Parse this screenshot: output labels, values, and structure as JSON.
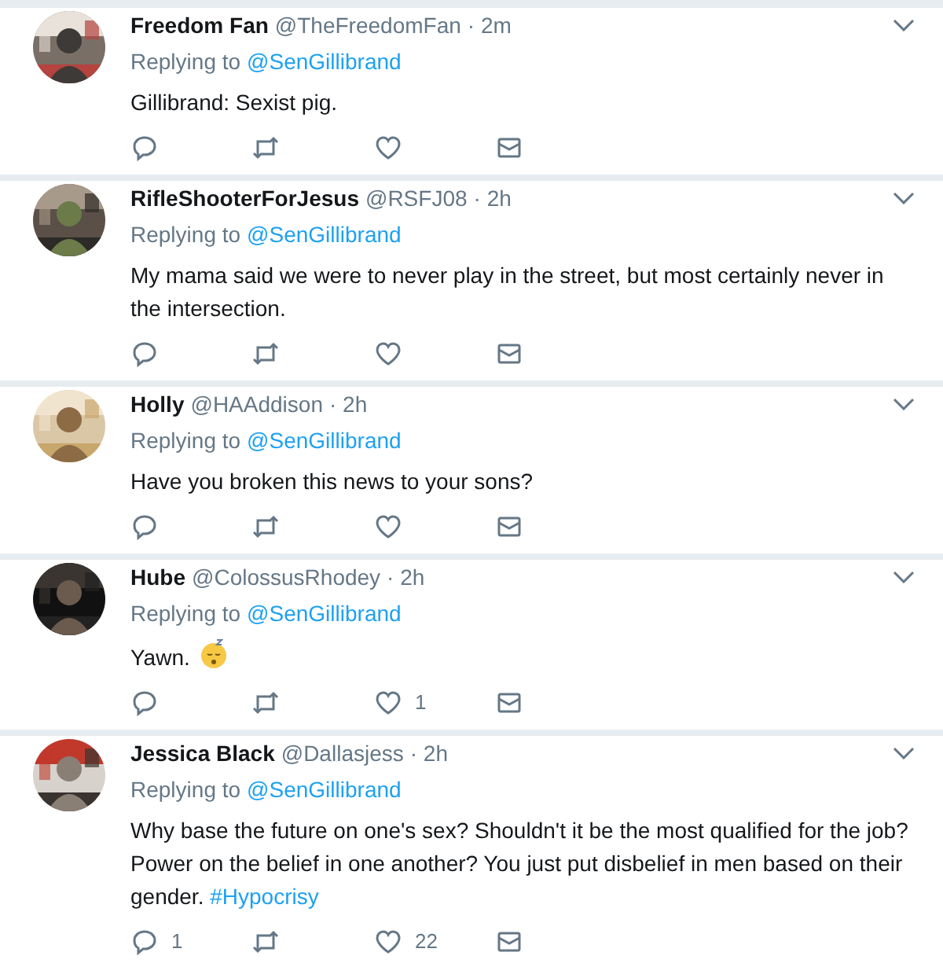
{
  "tweets": [
    {
      "name": "Freedom Fan",
      "handle": "@TheFreedomFan",
      "time": "· 2m",
      "replying_label": "Replying to",
      "replying_to": "@SenGillibrand",
      "body": "Gillibrand: Sexist pig."
    },
    {
      "name": "RifleShooterForJesus",
      "handle": "@RSFJ08",
      "time": "· 2h",
      "replying_label": "Replying to",
      "replying_to": "@SenGillibrand",
      "body": "My mama said we were to never play in the street, but most certainly never in the intersection."
    },
    {
      "name": "Holly",
      "handle": "@HAAddison",
      "time": "· 2h",
      "replying_label": "Replying to",
      "replying_to": "@SenGillibrand",
      "body": "Have you broken this news to your sons?"
    },
    {
      "name": "Hube",
      "handle": "@ColossusRhodey",
      "time": "· 2h",
      "replying_label": "Replying to",
      "replying_to": "@SenGillibrand",
      "body": "Yawn.",
      "sleepy_emoji": true,
      "like_count": "1"
    },
    {
      "name": "Jessica Black",
      "handle": "@Dallasjess",
      "time": "· 2h",
      "replying_label": "Replying to",
      "replying_to": "@SenGillibrand",
      "body": "Why base the future on one's sex? Shouldn't it be the most qualified for the job? Power on the belief in one another? You just put disbelief in men based on their gender.",
      "hashtag": "#Hypocrisy",
      "reply_count": "1",
      "like_count": "22"
    }
  ]
}
